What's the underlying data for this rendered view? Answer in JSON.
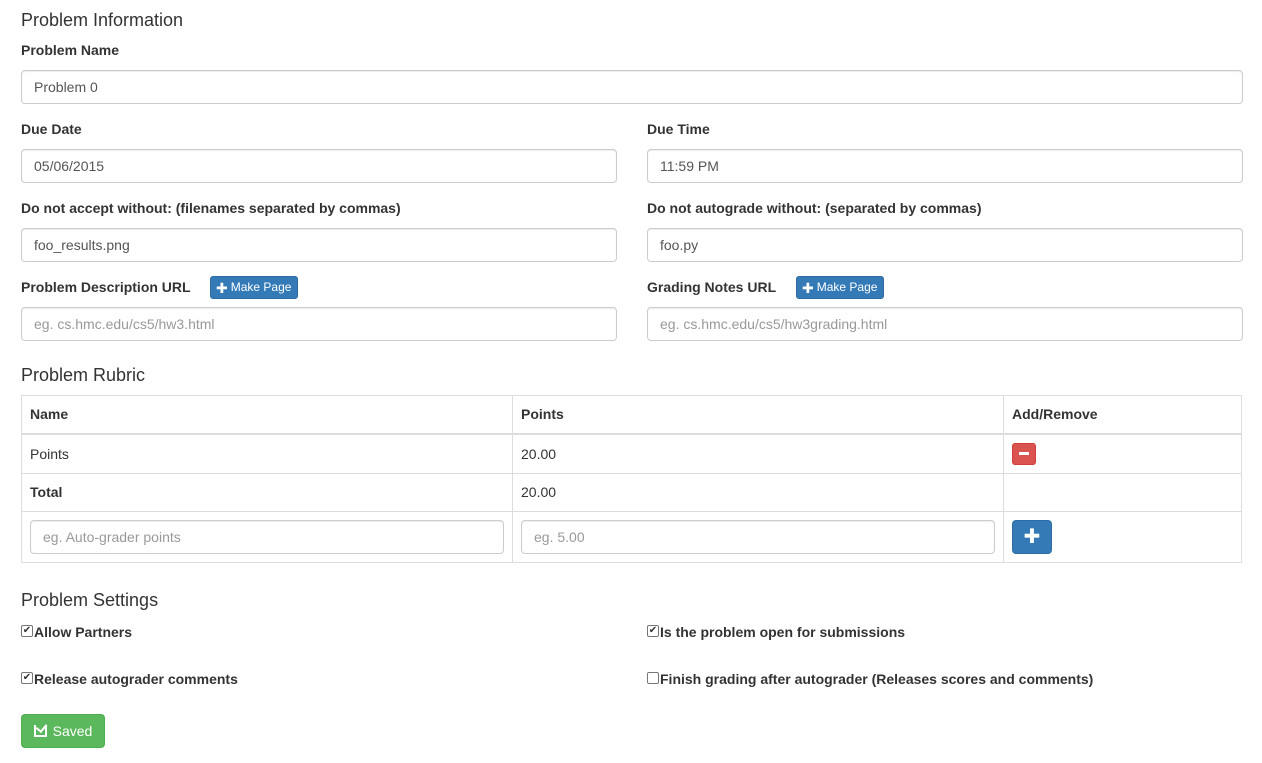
{
  "problem_info": {
    "heading": "Problem Information",
    "name_label": "Problem Name",
    "name_value": "Problem 0",
    "due_date_label": "Due Date",
    "due_date_value": "05/06/2015",
    "due_time_label": "Due Time",
    "due_time_value": "11:59 PM",
    "accept_label": "Do not accept without: (filenames separated by commas)",
    "accept_value": "foo_results.png",
    "autograde_label": "Do not autograde without: (separated by commas)",
    "autograde_value": "foo.py",
    "desc_url_label": "Problem Description URL",
    "desc_url_placeholder": "eg. cs.hmc.edu/cs5/hw3.html",
    "grading_url_label": "Grading Notes URL",
    "grading_url_placeholder": "eg. cs.hmc.edu/cs5/hw3grading.html",
    "make_page_label": "Make Page"
  },
  "rubric": {
    "heading": "Problem Rubric",
    "columns": [
      "Name",
      "Points",
      "Add/Remove"
    ],
    "rows": [
      {
        "name": "Points",
        "points": "20.00"
      }
    ],
    "total_label": "Total",
    "total_value": "20.00",
    "new_name_placeholder": "eg. Auto-grader points",
    "new_points_placeholder": "eg. 5.00"
  },
  "settings": {
    "heading": "Problem Settings",
    "allow_partners": {
      "label": "Allow Partners",
      "checked": true
    },
    "open_submissions": {
      "label": "Is the problem open for submissions",
      "checked": true
    },
    "release_comments": {
      "label": "Release autograder comments",
      "checked": true
    },
    "finish_grading": {
      "label": "Finish grading after autograder (Releases scores and comments)",
      "checked": false
    }
  },
  "save_button": {
    "label": "Saved",
    "color": "#5cb85c"
  },
  "colors": {
    "primary": "#337ab7",
    "danger": "#d9534f",
    "success": "#5cb85c"
  }
}
